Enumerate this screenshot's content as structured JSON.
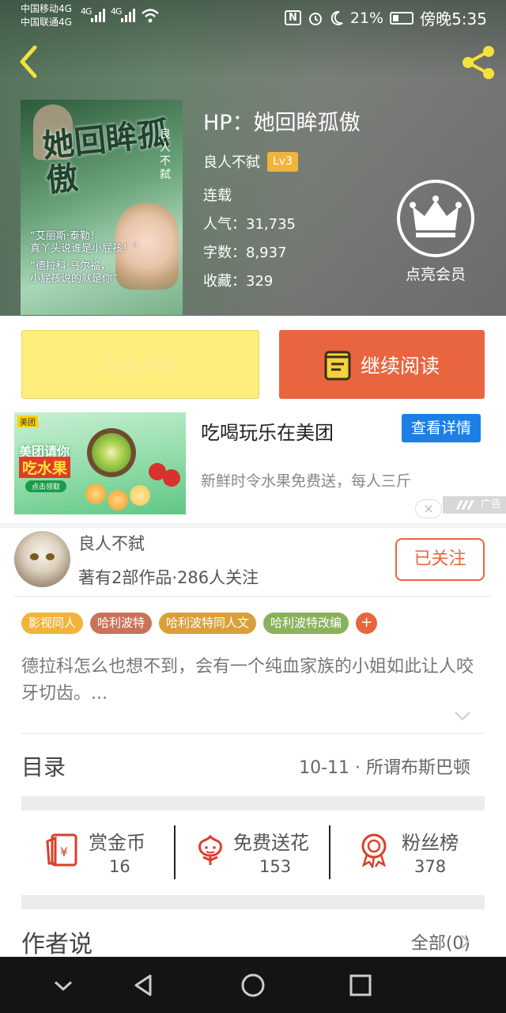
{
  "status_bar": {
    "carrier1": "中国移动4G",
    "carrier2": "中国联通4G",
    "signal1": "4G",
    "signal2": "4G",
    "nfc": "N",
    "battery": "21%",
    "time": "傍晚5:35"
  },
  "book": {
    "title": "HP：她回眸孤傲",
    "author": "良人不弑",
    "level": "Lv3",
    "status": "连载",
    "popularity": "人气：31,735",
    "words": "字数：8,937",
    "collections": "收藏：329",
    "cover_title": "她回眸孤傲",
    "cover_author": "良人不弑",
    "cover_quote1": "“艾丽斯·泰勒！\n真丫头说谁是小屁孩！”",
    "cover_quote2": "“德拉科·马尔福，\n小屁孩说的就是你”"
  },
  "vip": {
    "label": "点亮会员"
  },
  "actions": {
    "shelf_label": "已在书架",
    "read_label": "继续阅读"
  },
  "ad": {
    "brand": "美团",
    "image_headline1": "美团请你",
    "image_headline2": "吃水果",
    "image_button": "点击领取",
    "title": "吃喝玩乐在美团",
    "cta": "查看详情",
    "description": "新鲜时令水果免费送，每人三斤",
    "close": "×",
    "tag": "广告"
  },
  "author_card": {
    "name": "良人不弑",
    "stats": "著有2部作品·286人关注",
    "follow_label": "已关注"
  },
  "tags": [
    {
      "label": "影视同人",
      "color": "#f2b33a"
    },
    {
      "label": "哈利波特",
      "color": "#c9735a"
    },
    {
      "label": "哈利波特同人文",
      "color": "#d9a03a"
    },
    {
      "label": "哈利波特改编",
      "color": "#8ab15c"
    }
  ],
  "tag_more": "+",
  "synopsis": "德拉科怎么也想不到，会有一个纯血家族的小姐如此让人咬牙切齿。...",
  "directory": {
    "label": "目录",
    "latest": "10-11 · 所谓布斯巴顿"
  },
  "stats": {
    "coins": {
      "label": "赏金币",
      "value": "16"
    },
    "flowers": {
      "label": "免费送花",
      "value": "153"
    },
    "fans": {
      "label": "粉丝榜",
      "value": "378"
    }
  },
  "author_said": {
    "label": "作者说",
    "all": "全部(0)"
  },
  "colors": {
    "accent": "#e9653f",
    "shelf_button": "#ffee7b",
    "ad_cta": "#1c7fe6",
    "level_badge": "#f2b33a"
  }
}
